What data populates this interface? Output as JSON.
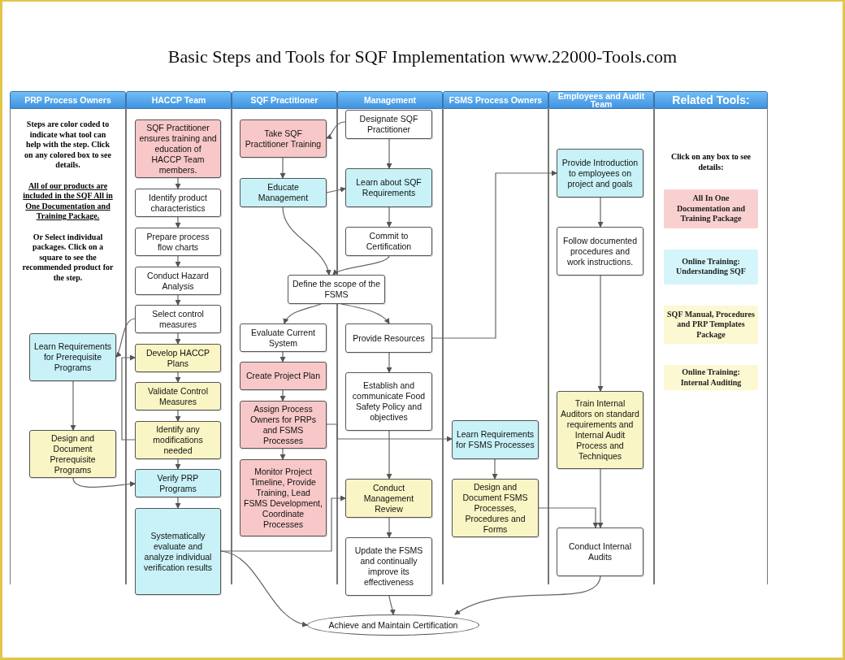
{
  "title": "Basic Steps and Tools for SQF Implementation www.22000-Tools.com",
  "lanes": [
    {
      "header": "PRP Process Owners",
      "notes": [
        {
          "kind": "plain",
          "text": "Steps are color coded to indicate what tool can help with the step. Click on any colored box to see details."
        },
        {
          "kind": "underlined",
          "text": "All of our products are included in the SQF All in One Documentation and Training Package."
        },
        {
          "kind": "plain",
          "text": "Or Select individual packages. Click on a square to see the recommended product for the step."
        }
      ],
      "nodes": [
        {
          "text": "Learn Requirements for Prerequisite Programs",
          "color": "#c8f2f7"
        },
        {
          "text": "Design and Document Prerequisite Programs",
          "color": "#faf5c4"
        }
      ]
    },
    {
      "header": "HACCP Team",
      "nodes": [
        {
          "text": "SQF Practitioner ensures training and education of HACCP Team members.",
          "color": "#f8c8c8"
        },
        {
          "text": "Identify product characteristics",
          "color": "#ffffff"
        },
        {
          "text": "Prepare process flow charts",
          "color": "#ffffff"
        },
        {
          "text": "Conduct Hazard Analysis",
          "color": "#ffffff"
        },
        {
          "text": "Select control measures",
          "color": "#ffffff"
        },
        {
          "text": "Develop HACCP Plans",
          "color": "#faf5c4"
        },
        {
          "text": "Validate Control Measures",
          "color": "#faf5c4"
        },
        {
          "text": "Identify any modifications needed",
          "color": "#faf5c4"
        },
        {
          "text": "Verify PRP Programs",
          "color": "#c8f2f7"
        },
        {
          "text": "Systematically evaluate and analyze individual verification results",
          "color": "#c8f2f7"
        }
      ]
    },
    {
      "header": "SQF Practitioner",
      "nodes": [
        {
          "text": "Take SQF Practitioner Training",
          "color": "#f8c8c8"
        },
        {
          "text": "Educate Management",
          "color": "#c8f2f7"
        },
        {
          "text": "Evaluate Current System",
          "color": "#ffffff"
        },
        {
          "text": "Create Project Plan",
          "color": "#f8c8c8"
        },
        {
          "text": "Assign Process Owners for PRPs and FSMS Processes",
          "color": "#f8c8c8"
        },
        {
          "text": "Monitor Project Timeline, Provide Training, Lead FSMS Development, Coordinate Processes",
          "color": "#f8c8c8"
        }
      ]
    },
    {
      "header": "Management",
      "nodes": [
        {
          "text": "Designate SQF Practitioner",
          "color": "#ffffff"
        },
        {
          "text": "Learn about SQF Requirements",
          "color": "#c8f2f7"
        },
        {
          "text": "Commit to Certification",
          "color": "#ffffff"
        },
        {
          "text": "Define the scope of the FSMS",
          "color": "#ffffff"
        },
        {
          "text": "Provide Resources",
          "color": "#ffffff"
        },
        {
          "text": "Establish and communicate Food Safety Policy and objectives",
          "color": "#ffffff"
        },
        {
          "text": "Conduct Management Review",
          "color": "#faf5c4"
        },
        {
          "text": "Update the FSMS and continually improve its effectiveness",
          "color": "#ffffff"
        }
      ]
    },
    {
      "header": "FSMS Process Owners",
      "nodes": [
        {
          "text": "Learn Requirements for FSMS Processes",
          "color": "#c8f2f7"
        },
        {
          "text": "Design and Document FSMS Processes, Procedures and Forms",
          "color": "#faf5c4"
        }
      ]
    },
    {
      "header": "Employees and Audit Team",
      "nodes": [
        {
          "text": "Provide Introduction to employees on project and goals",
          "color": "#c8f2f7"
        },
        {
          "text": "Follow documented procedures and work instructions.",
          "color": "#ffffff"
        },
        {
          "text": "Train Internal Auditors on standard requirements and Internal Audit Process and Techniques",
          "color": "#faf5c4"
        },
        {
          "text": "Conduct Internal Audits",
          "color": "#ffffff"
        }
      ]
    }
  ],
  "related_tools": {
    "header": "Related Tools:",
    "instruction": "Click on any box to see details:",
    "tools": [
      {
        "label": "All In One Documentation and Training Package",
        "color": "#f9d0d0"
      },
      {
        "label": "Online Training: Understanding SQF",
        "color": "#d4f6fa"
      },
      {
        "label": "SQF Manual, Procedures and PRP Templates Package",
        "color": "#fbf8d2"
      },
      {
        "label": "Online Training: Internal Auditing",
        "color": "#fbf8d2"
      }
    ]
  },
  "end_node": {
    "text": "Achieve and Maintain Certification"
  }
}
